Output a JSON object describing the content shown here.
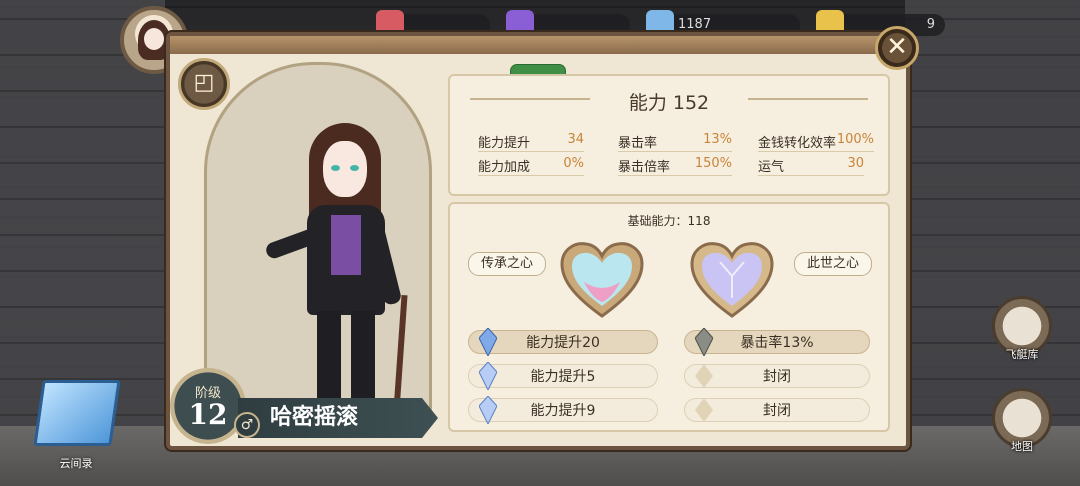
{
  "top_bar": {
    "resources": [
      {
        "name": "red-resource-icon",
        "value": ""
      },
      {
        "name": "purple-resource-icon",
        "value": ""
      },
      {
        "name": "blue-resource-icon",
        "value": "1187"
      },
      {
        "name": "gold-resource-icon",
        "value": "9"
      }
    ]
  },
  "panel": {
    "close_label": "✕",
    "outfit_icon": "shirt-icon",
    "rank": {
      "title": "阶级",
      "value": "12"
    },
    "character_name": "哈密摇滚",
    "gender_symbol": "♂"
  },
  "stats": {
    "title": "能力 152",
    "items": [
      {
        "label": "能力提升",
        "value": "34"
      },
      {
        "label": "暴击率",
        "value": "13%"
      },
      {
        "label": "金钱转化效率",
        "value": "100%"
      },
      {
        "label": "能力加成",
        "value": "0%"
      },
      {
        "label": "暴击倍率",
        "value": "150%"
      },
      {
        "label": "运气",
        "value": "30"
      }
    ]
  },
  "hearts": {
    "base_power": "基础能力：118",
    "left_label": "传承之心",
    "right_label": "此世之心",
    "left_slots": [
      "能力提升20",
      "能力提升5",
      "能力提升9"
    ],
    "right_slots": [
      "暴击率13%",
      "封闭",
      "封闭"
    ]
  },
  "side": {
    "airship_label": "飞艇库",
    "map_label": "地图",
    "book_label": "云间录"
  },
  "colors": {
    "panel_bg": "#efe6d3",
    "accent_value": "#c8843a",
    "frame_brown": "#6c5440",
    "name_plate": "#2f3d40"
  }
}
